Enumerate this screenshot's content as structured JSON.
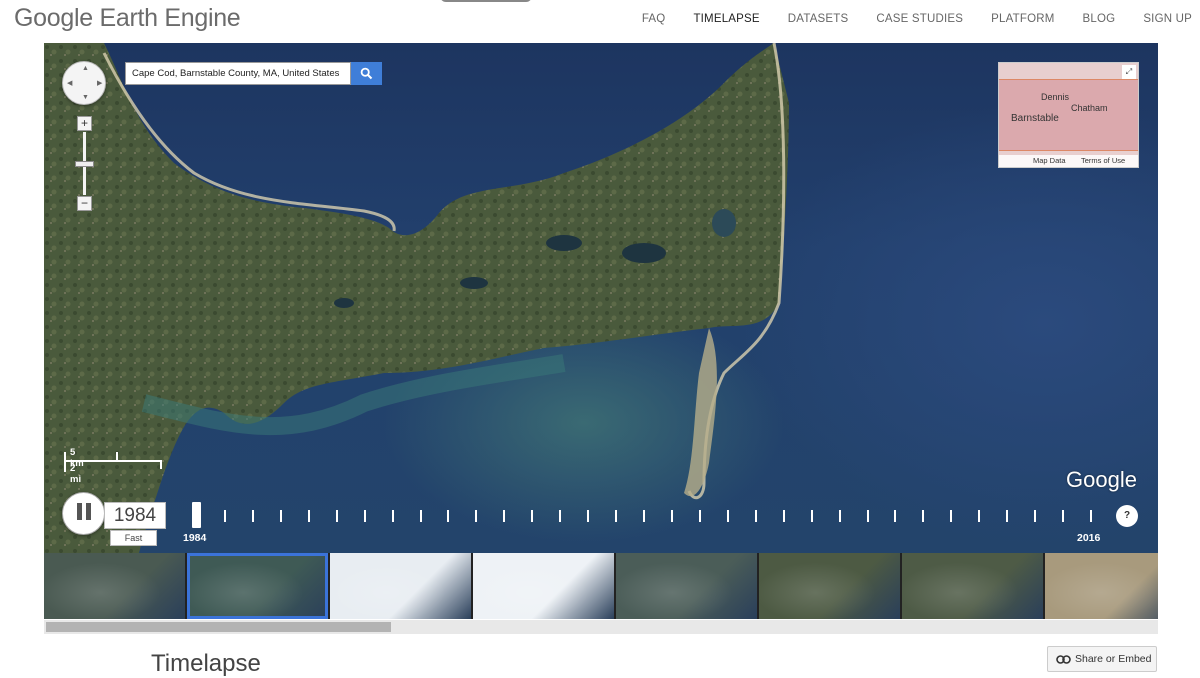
{
  "header": {
    "logo": "Google Earth Engine",
    "nav": [
      {
        "label": "FAQ",
        "active": false
      },
      {
        "label": "TIMELAPSE",
        "active": true
      },
      {
        "label": "DATASETS",
        "active": false
      },
      {
        "label": "CASE STUDIES",
        "active": false
      },
      {
        "label": "PLATFORM",
        "active": false
      },
      {
        "label": "BLOG",
        "active": false
      },
      {
        "label": "SIGN UP",
        "active": false
      }
    ]
  },
  "search": {
    "value": "Cape Cod, Barnstable County, MA, United States",
    "icon": "search-icon"
  },
  "zoom": {
    "plus": "+",
    "minus": "−"
  },
  "minimap": {
    "labels": [
      "Dennis",
      "Chatham",
      "Barnstable"
    ],
    "map_data": "Map Data",
    "terms": "Terms of Use",
    "expand_icon": "expand-icon"
  },
  "scale": {
    "km": "5 km",
    "mi": "2 mi"
  },
  "watermark": "Google",
  "timeline": {
    "current_year": "1984",
    "speed": "Fast",
    "start_year": "1984",
    "end_year": "2016",
    "help": "?",
    "year_count": 33,
    "progress": 0.0
  },
  "thumbnails": {
    "count": 8,
    "selected_index": 1,
    "colors": [
      "#4a5a52",
      "#3f5a55",
      "#e8edf2",
      "#eef2f6",
      "#4b5d58",
      "#4d5a43",
      "#4e5b46",
      "#a89a7d"
    ]
  },
  "footer": {
    "section_title": "Timelapse",
    "share_label": "Share or Embed",
    "share_icon": "link-icon"
  }
}
